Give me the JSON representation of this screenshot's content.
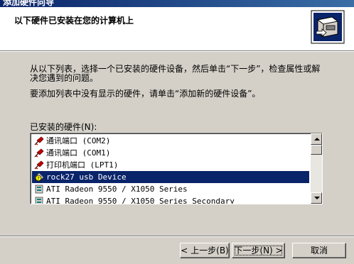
{
  "window": {
    "title": "添加硬件向导"
  },
  "header": {
    "title": "以下硬件已安装在您的计算机上"
  },
  "instructions": {
    "line1": "从以下列表，选择一个已安装的硬件设备，然后单击“下一步”，检查属性或解决您遇到的问题。",
    "line2": "要添加列表中没有显示的硬件，请单击“添加新的硬件设备”。"
  },
  "hardware_list": {
    "label": "已安装的硬件(N):",
    "items": [
      {
        "label": "通讯端口 (COM2)",
        "icon": "port-icon"
      },
      {
        "label": "通讯端口 (COM1)",
        "icon": "port-icon"
      },
      {
        "label": "打印机端口 (LPT1)",
        "icon": "port-icon"
      },
      {
        "label": "rock27 usb Device",
        "icon": "warning-device-icon",
        "selected": true
      },
      {
        "label": "ATI Radeon 9550 / X1050 Series",
        "icon": "display-adapter-icon"
      },
      {
        "label": "ATI Radeon 9550 / X1050 Series Secondary",
        "icon": "display-adapter-icon"
      }
    ]
  },
  "buttons": {
    "back": "< 上一步(B)",
    "next": "下一步(N) >",
    "cancel": "取消"
  }
}
